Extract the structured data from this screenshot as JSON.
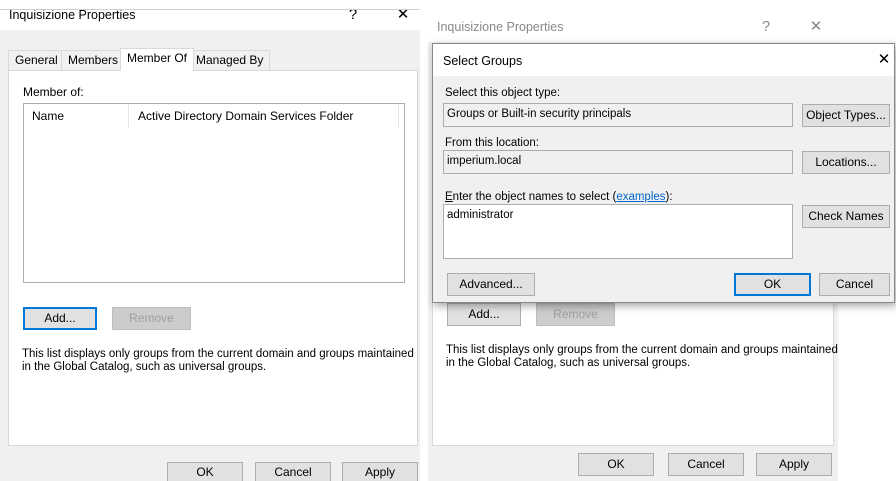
{
  "left_window": {
    "title": "Inquisizione Properties",
    "help_label": "?",
    "close_label": "✕",
    "tabs": [
      "General",
      "Members",
      "Member Of",
      "Managed By"
    ],
    "member_of_label": "Member of:",
    "columns": [
      "Name",
      "Active Directory Domain Services Folder"
    ],
    "add_label": "Add...",
    "remove_label": "Remove",
    "info_line1": "This list displays only groups from the current domain and groups maintained",
    "info_line2": "in the Global Catalog, such as universal groups.",
    "ok_label": "OK",
    "cancel_label": "Cancel",
    "apply_label": "Apply"
  },
  "right_window": {
    "title": "Inquisizione Properties",
    "help_label": "?",
    "close_label": "✕",
    "add_label": "Add...",
    "remove_label": "Remove",
    "info_line1": "This list displays only groups from the current domain and groups maintained",
    "info_line2": "in the Global Catalog, such as universal groups.",
    "ok_label": "OK",
    "cancel_label": "Cancel",
    "apply_label": "Apply"
  },
  "select_groups": {
    "title": "Select Groups",
    "close_label": "✕",
    "object_type_label": "Select this object type:",
    "object_type_value": "Groups or Built-in security principals",
    "object_types_button": "Object Types...",
    "location_label": "From this location:",
    "location_value": "imperium.local",
    "locations_button": "Locations...",
    "enter_names_first": "E",
    "enter_names_rest": "nter the object names to select (",
    "examples_link": "examples",
    "enter_names_end": "):",
    "names_value": "administrator",
    "check_names_button": "Check Names",
    "advanced_button": "Advanced...",
    "ok_label": "OK",
    "cancel_label": "Cancel"
  }
}
